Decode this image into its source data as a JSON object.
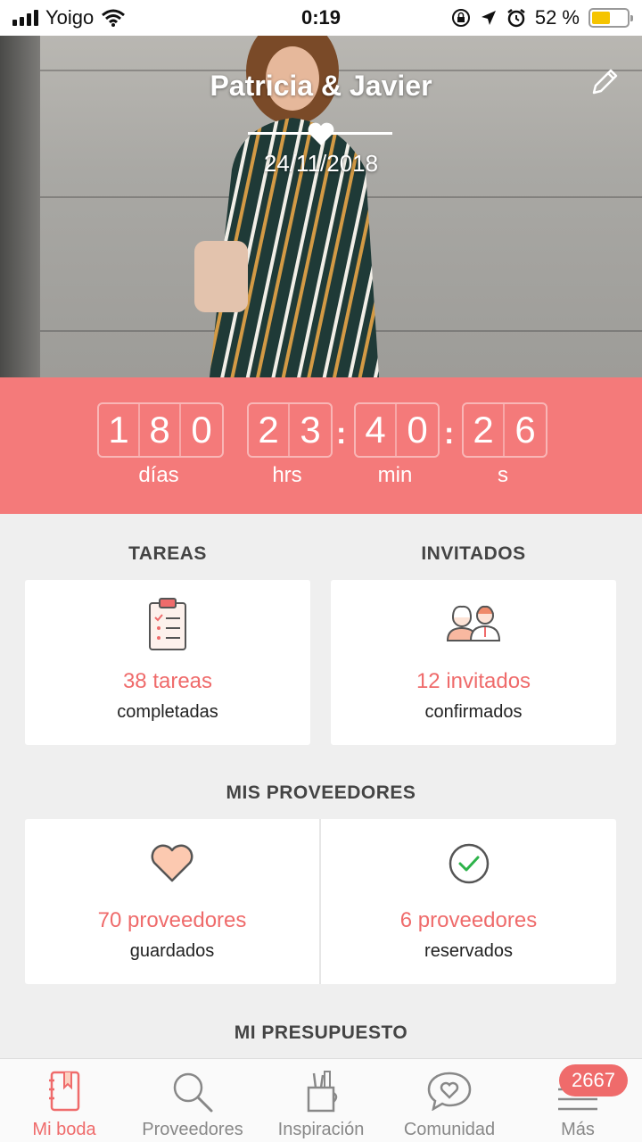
{
  "status_bar": {
    "carrier": "Yoigo",
    "time": "0:19",
    "battery": "52 %",
    "battery_level": 0.52
  },
  "hero": {
    "couple_names": "Patricia & Javier",
    "wedding_date": "24/11/2018"
  },
  "countdown": {
    "days_digits": [
      "1",
      "8",
      "0"
    ],
    "hours_digits": [
      "2",
      "3"
    ],
    "minutes_digits": [
      "4",
      "0"
    ],
    "seconds_digits": [
      "2",
      "6"
    ],
    "labels": {
      "days": "días",
      "hours": "hrs",
      "minutes": "min",
      "seconds": "s"
    },
    "separator": ":"
  },
  "tasks": {
    "title": "TAREAS",
    "count_text": "38 tareas",
    "subtitle": "completadas"
  },
  "guests": {
    "title": "INVITADOS",
    "count_text": "12 invitados",
    "subtitle": "confirmados"
  },
  "vendors": {
    "title": "MIS PROVEEDORES",
    "saved_text": "70 proveedores",
    "saved_subtitle": "guardados",
    "booked_text": "6 proveedores",
    "booked_subtitle": "reservados"
  },
  "budget": {
    "title": "MI PRESUPUESTO"
  },
  "tab_bar": {
    "items": [
      {
        "label": "Mi boda",
        "icon": "notebook-icon",
        "active": true
      },
      {
        "label": "Proveedores",
        "icon": "search-icon",
        "active": false
      },
      {
        "label": "Inspiración",
        "icon": "tools-jar-icon",
        "active": false
      },
      {
        "label": "Comunidad",
        "icon": "chat-heart-icon",
        "active": false
      },
      {
        "label": "Más",
        "icon": "menu-icon",
        "active": false
      }
    ],
    "badge": "2667"
  },
  "colors": {
    "accent": "#f47a7a",
    "accent_text": "#ef6b6b",
    "background": "#efefef"
  }
}
